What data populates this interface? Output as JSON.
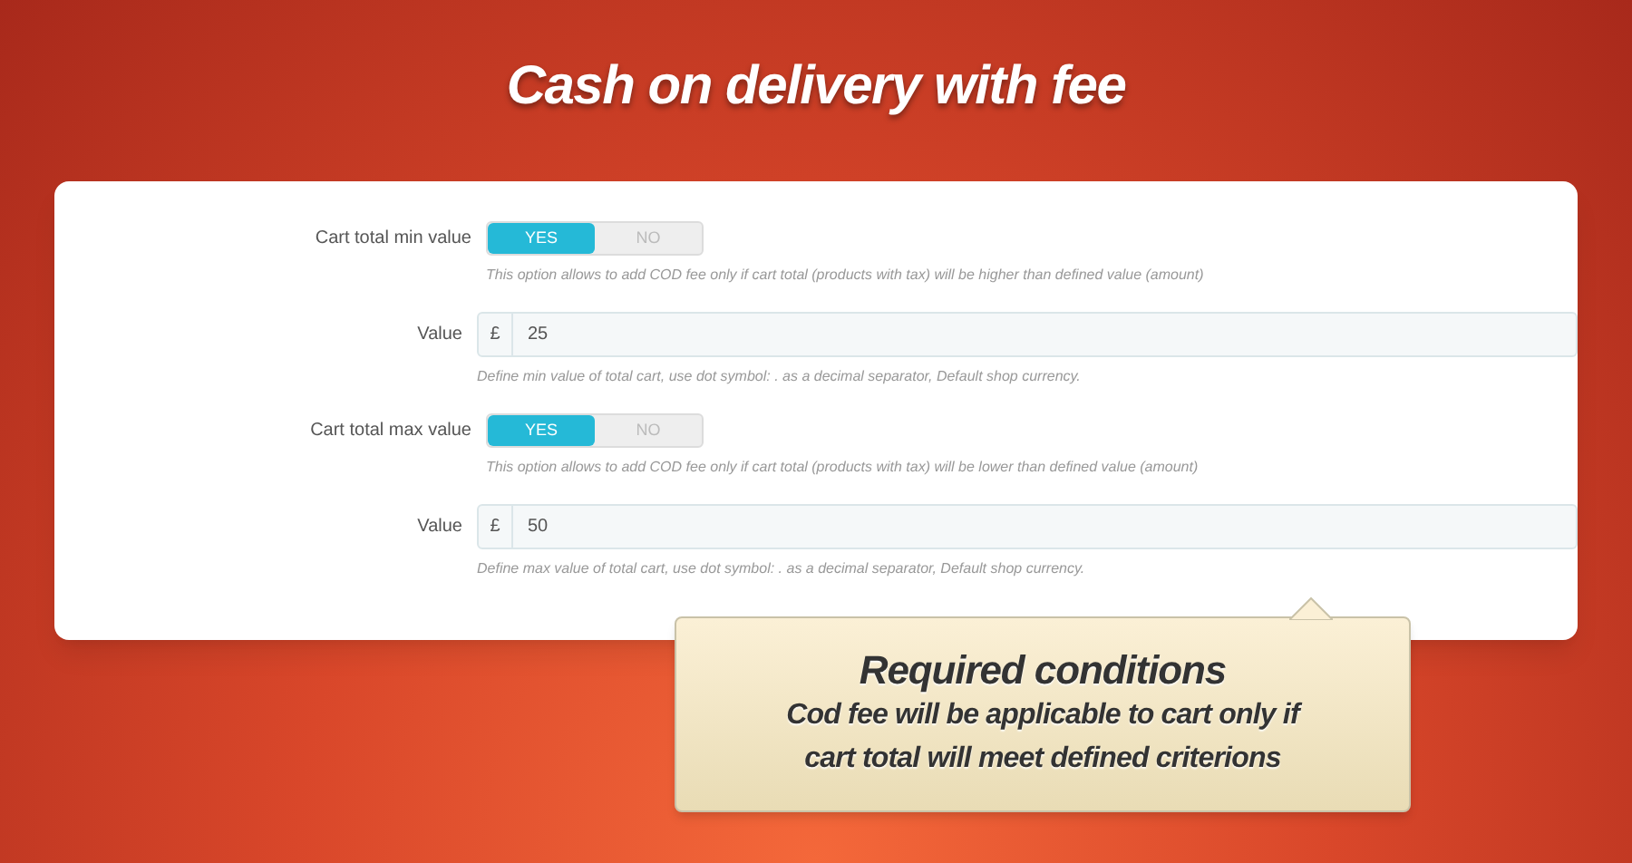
{
  "title": "Cash on delivery with fee",
  "rows": [
    {
      "kind": "toggle",
      "label": "Cart total min value",
      "options": [
        {
          "label": "YES",
          "selected": true
        },
        {
          "label": "NO",
          "selected": false
        }
      ],
      "help": "This option allows to add COD fee only if cart total (products with tax) will be higher than defined value (amount)"
    },
    {
      "kind": "input",
      "label": "Value",
      "prefix": "£",
      "value": "25",
      "help": "Define min value of total cart, use dot symbol: . as a decimal separator, Default shop currency."
    },
    {
      "kind": "toggle",
      "label": "Cart total max value",
      "options": [
        {
          "label": "YES",
          "selected": true
        },
        {
          "label": "NO",
          "selected": false
        }
      ],
      "help": "This option allows to add COD fee only if cart total (products with tax) will be lower than defined value (amount)"
    },
    {
      "kind": "input",
      "label": "Value",
      "prefix": "£",
      "value": "50",
      "help": "Define max value of total cart, use dot symbol: . as a decimal separator, Default shop currency."
    }
  ],
  "callout": {
    "heading": "Required conditions",
    "lines": [
      "Cod fee will be applicable to cart only if",
      "cart total will meet defined criterions"
    ]
  }
}
